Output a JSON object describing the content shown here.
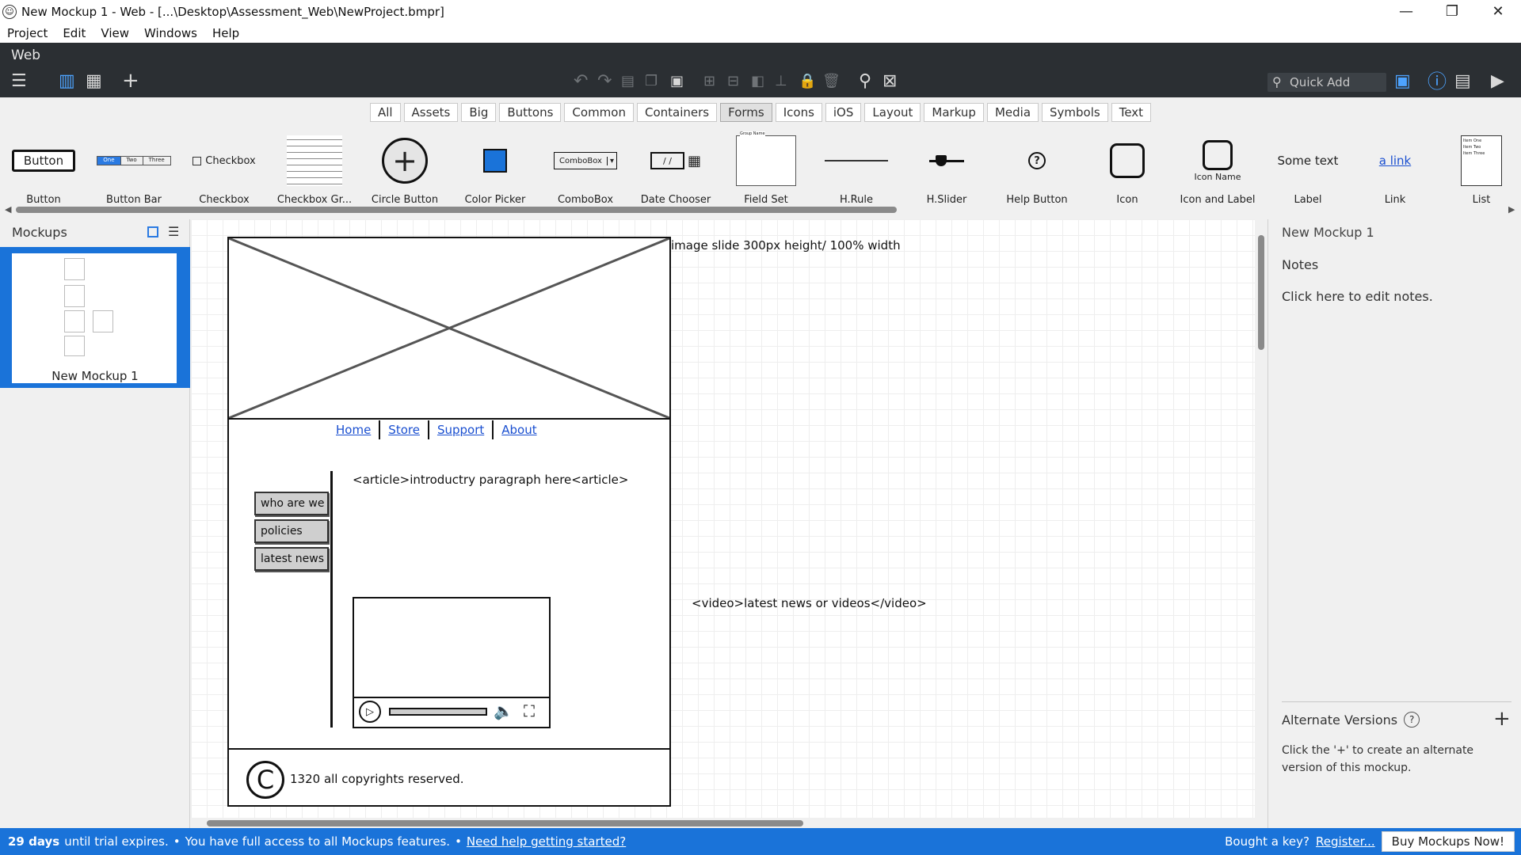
{
  "window": {
    "title": "New Mockup 1 - Web - [...\\Desktop\\Assessment_Web\\NewProject.bmpr]",
    "minimize": "—",
    "restore": "❐",
    "close": "✕"
  },
  "menu": [
    "Project",
    "Edit",
    "View",
    "Windows",
    "Help"
  ],
  "toolbar": {
    "project_name": "Web",
    "quick_add_placeholder": "Quick Add"
  },
  "filter_tabs": [
    {
      "label": "All",
      "active": false
    },
    {
      "label": "Assets",
      "active": false
    },
    {
      "label": "Big",
      "active": false
    },
    {
      "label": "Buttons",
      "active": false
    },
    {
      "label": "Common",
      "active": false
    },
    {
      "label": "Containers",
      "active": false
    },
    {
      "label": "Forms",
      "active": true
    },
    {
      "label": "Icons",
      "active": false
    },
    {
      "label": "iOS",
      "active": false
    },
    {
      "label": "Layout",
      "active": false
    },
    {
      "label": "Markup",
      "active": false
    },
    {
      "label": "Media",
      "active": false
    },
    {
      "label": "Symbols",
      "active": false
    },
    {
      "label": "Text",
      "active": false
    }
  ],
  "library": {
    "items": [
      "Button",
      "Button Bar",
      "Checkbox",
      "Checkbox Gr...",
      "Circle Button",
      "Color Picker",
      "ComboBox",
      "Date Chooser",
      "Field Set",
      "H.Rule",
      "H.Slider",
      "Help Button",
      "Icon",
      "Icon and Label",
      "Label",
      "Link",
      "List"
    ],
    "previews": {
      "button": "Button",
      "button_bar": [
        "One",
        "Two",
        "Three"
      ],
      "checkbox": "Checkbox",
      "combobox": "ComboBox",
      "date": "/ /",
      "fieldset": "Group Name",
      "icon_label": "Icon Name",
      "label": "Some text",
      "link": "a link",
      "list": [
        "Item One",
        "Item Two",
        "Item Three"
      ]
    }
  },
  "mockups_panel": {
    "title": "Mockups",
    "mockup_name": "New Mockup 1"
  },
  "canvas": {
    "image_note": "image slide 300px height/ 100% width",
    "nav": [
      "Home",
      "Store",
      "Support",
      "About"
    ],
    "article": "<article>introductry paragraph here<article>",
    "side_buttons": [
      "who are we",
      "policies",
      "latest news"
    ],
    "video_note": "<video>latest news or videos</video>",
    "copyright_symbol": "C",
    "copyright": "1320 all copyrights reserved."
  },
  "right_panel": {
    "title": "New Mockup 1",
    "notes_heading": "Notes",
    "notes_placeholder": "Click here to edit notes.",
    "alt_heading": "Alternate Versions",
    "alt_help": "?",
    "alt_text": "Click the '+' to create an alternate version of this mockup."
  },
  "status": {
    "days": "29 days",
    "trial": "until trial expires.",
    "sep": "•",
    "access": "You have full access to all Mockups features.",
    "help_link": "Need help getting started?",
    "bought": "Bought a key?",
    "register": "Register...",
    "buy": "Buy Mockups Now!"
  }
}
